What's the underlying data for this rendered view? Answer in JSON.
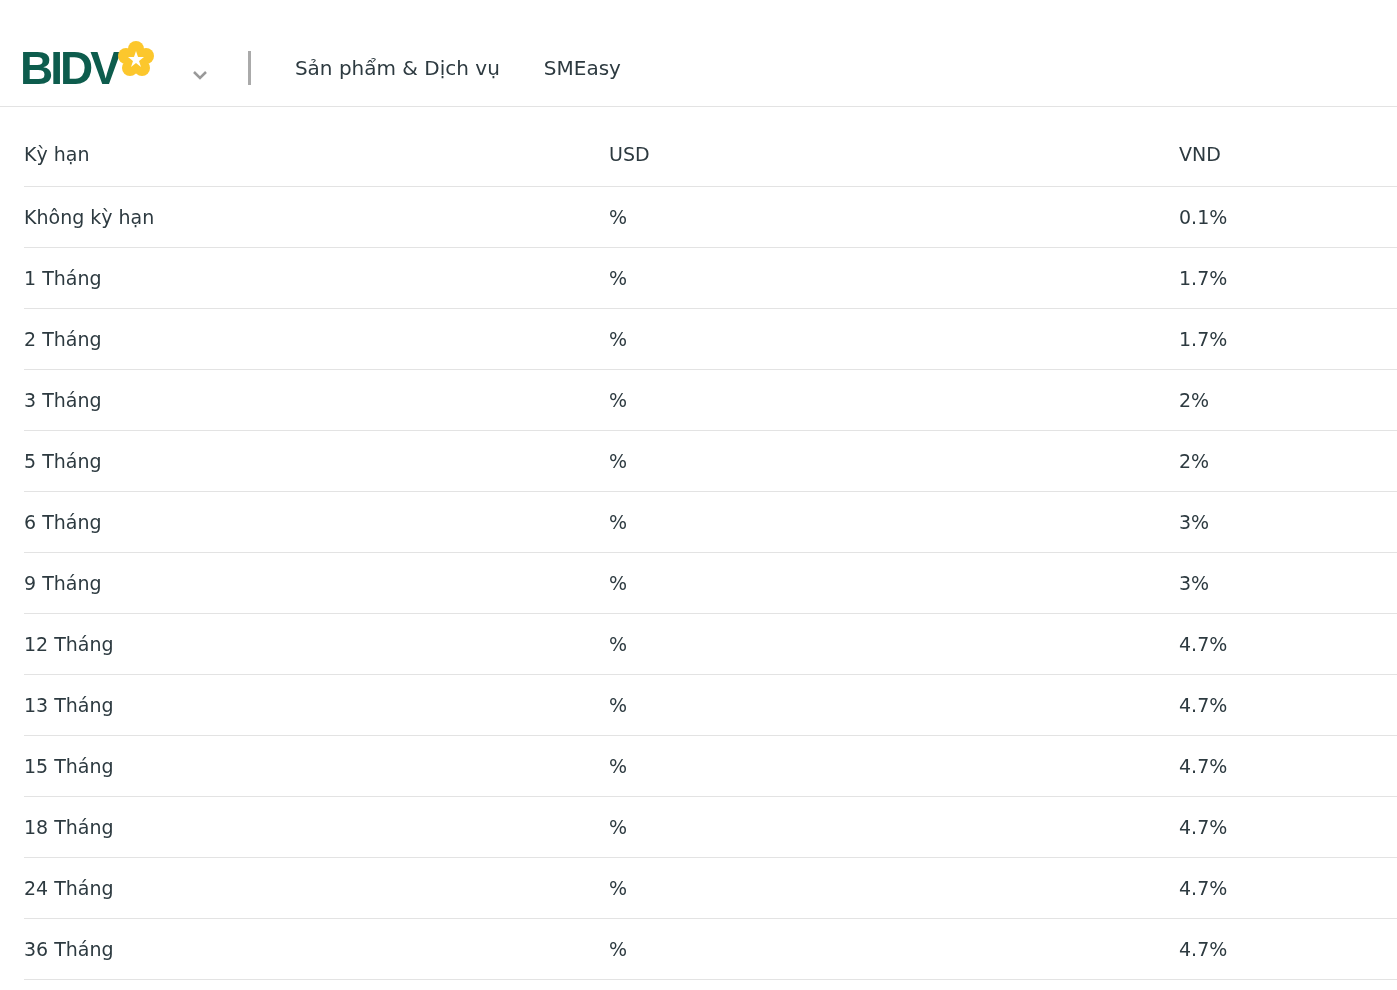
{
  "header": {
    "logo": "BIDV",
    "nav": [
      "Sản phẩm & Dịch vụ",
      "SMEasy"
    ]
  },
  "table": {
    "columns": [
      "Kỳ hạn",
      "USD",
      "VND"
    ],
    "rows": [
      [
        "Không kỳ hạn",
        "%",
        "0.1%"
      ],
      [
        "1 Tháng",
        "%",
        "1.7%"
      ],
      [
        "2 Tháng",
        "%",
        "1.7%"
      ],
      [
        "3 Tháng",
        "%",
        "2%"
      ],
      [
        "5 Tháng",
        "%",
        "2%"
      ],
      [
        "6 Tháng",
        "%",
        "3%"
      ],
      [
        "9 Tháng",
        "%",
        "3%"
      ],
      [
        "12 Tháng",
        "%",
        "4.7%"
      ],
      [
        "13 Tháng",
        "%",
        "4.7%"
      ],
      [
        "15 Tháng",
        "%",
        "4.7%"
      ],
      [
        "18 Tháng",
        "%",
        "4.7%"
      ],
      [
        "24 Tháng",
        "%",
        "4.7%"
      ],
      [
        "36 Tháng",
        "%",
        "4.7%"
      ]
    ]
  }
}
